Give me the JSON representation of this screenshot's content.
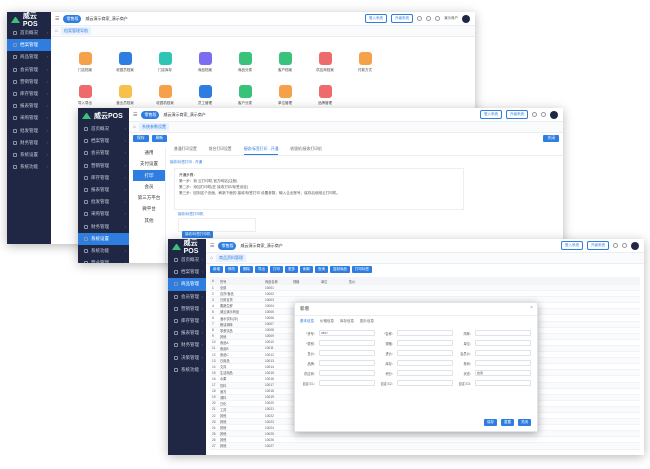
{
  "brand": "威云POS",
  "colors": {
    "sidebar": "#1f2744",
    "accent": "#2e7de0",
    "green": "#39c27a"
  },
  "w1": {
    "topbar": {
      "badge": "零售版",
      "store": "威云演示商家_演示商户",
      "btn1": "登入系统",
      "btn2": "升级系统",
      "user": "演示商户"
    },
    "tab": "档案管理导航",
    "nav": [
      "首页概况",
      "档案管理",
      "商品管理",
      "会员管理",
      "营销管理",
      "库存管理",
      "报表管理",
      "采购管理",
      "批发管理",
      "财务管理",
      "系统设置",
      "系统功能"
    ],
    "grid": [
      {
        "label": "门店档案",
        "color": "#f5a14a"
      },
      {
        "label": "收银员档案",
        "color": "#2e7de0"
      },
      {
        "label": "门店库存",
        "color": "#2ec4b6"
      },
      {
        "label": "商品档案",
        "color": "#7b6cf0"
      },
      {
        "label": "商品分类",
        "color": "#39c27a"
      },
      {
        "label": "客户档案",
        "color": "#39c27a"
      },
      {
        "label": "供应商档案",
        "color": "#ef6b6b"
      },
      {
        "label": "付款方式",
        "color": "#f5a14a"
      },
      {
        "label": "导入导出",
        "color": "#ef6b6b"
      },
      {
        "label": "营业员档案",
        "color": "#f5c14a"
      },
      {
        "label": "收银机档案",
        "color": "#f5a14a"
      },
      {
        "label": "员工管理",
        "color": "#2e7de0"
      },
      {
        "label": "客户分类",
        "color": "#39c27a"
      },
      {
        "label": "单位管理",
        "color": "#f5a14a"
      },
      {
        "label": "品牌管理",
        "color": "#ef6b6b"
      }
    ]
  },
  "w2": {
    "topbar": {
      "badge": "零售版",
      "store": "威云演示商家_演示商户",
      "btn1": "登入系统",
      "btn2": "升级系统"
    },
    "tab": "系统参数设置",
    "nav": [
      "首页概况",
      "档案管理",
      "会员管理",
      "营销管理",
      "库存管理",
      "报表管理",
      "批发管理",
      "采购管理",
      "财务管理",
      "系统设置",
      "系统功能",
      "营业管理",
      "决策管理",
      "系统功能"
    ],
    "toolbar": {
      "save": "保存",
      "refresh": "刷新",
      "right": "关闭"
    },
    "sub_left": [
      "通用",
      "支付设置",
      "打印",
      "会员",
      "第三方平台",
      "微平台",
      "其他"
    ],
    "sub_active": 2,
    "sub_tabs": [
      "普通打印设置",
      "前台打印设置",
      "接收/标签打印 - 开通",
      "收银机/接收打印机"
    ],
    "sub_tab_active": 2,
    "link": "接收/标签打印 - 开通",
    "steps": [
      "开通步骤：",
      "第一步：到 云打印机 官方网站(注册)",
      "第二步：添加打印机(在 接收打印/标签设定)",
      "第三步：回到这个页面，刷新下面的 接收/标签打印 设置参数，输入企业账号，保存后使用云打印机。"
    ],
    "link2": "接收/标签打印机",
    "box_btn": "接收/标签打印机"
  },
  "w3": {
    "topbar": {
      "badge": "零售版",
      "store": "威云演示商家_演示商户",
      "btn1": "登入系统",
      "btn2": "升级系统"
    },
    "tab": "商品资料管理",
    "nav": [
      "首页概况",
      "档案管理",
      "商品管理",
      "会员管理",
      "营销管理",
      "库存管理",
      "报表管理",
      "财务管理",
      "决策管理",
      "系统功能"
    ],
    "toolbar": [
      "新增",
      "修改",
      "删除",
      "导出",
      "打印",
      "更多",
      "刷新",
      "查询",
      "复制商品",
      "打印标签"
    ],
    "table": {
      "head": [
        "#",
        "货号",
        "商品名称",
        "规格",
        "单位",
        "售价"
      ],
      "rows": [
        [
          "1",
          "全部",
          "10001",
          "",
          "",
          ""
        ],
        [
          "2",
          "百货/食品",
          "10002",
          "",
          "",
          ""
        ],
        [
          "3",
          "日用百货",
          "10003",
          "",
          "",
          ""
        ],
        [
          "4",
          "果蔬生鲜",
          "10004",
          "",
          "",
          ""
        ],
        [
          "5",
          "威云演示商品",
          "10005",
          "",
          "",
          ""
        ],
        [
          "6",
          "酒水饮料(中)",
          "10006",
          "",
          "",
          ""
        ],
        [
          "7",
          "粮油调味",
          "10007",
          "",
          "",
          ""
        ],
        [
          "8",
          "零食饮品",
          "10008",
          "",
          "",
          ""
        ],
        [
          "9",
          "其他",
          "10009",
          "",
          "",
          ""
        ],
        [
          "10",
          "食品A",
          "10010",
          "",
          "",
          ""
        ],
        [
          "11",
          "食品B",
          "10011",
          "",
          "",
          ""
        ],
        [
          "12",
          "食品C",
          "10012",
          "",
          "",
          ""
        ],
        [
          "13",
          "日用品",
          "10013",
          "",
          "",
          ""
        ],
        [
          "14",
          "文具",
          "10014",
          "",
          "",
          ""
        ],
        [
          "15",
          "生活用品",
          "10015",
          "",
          "",
          ""
        ],
        [
          "16",
          "水果",
          "10016",
          "",
          "",
          ""
        ],
        [
          "17",
          "饮料",
          "10017",
          "",
          "",
          ""
        ],
        [
          "18",
          "速冻",
          "10018",
          "",
          "",
          ""
        ],
        [
          "19",
          "调料",
          "10019",
          "",
          "",
          ""
        ],
        [
          "20",
          "日化",
          "10020",
          "",
          "",
          ""
        ],
        [
          "21",
          "工具",
          "10021",
          "",
          "",
          ""
        ],
        [
          "22",
          "其他",
          "10022",
          "",
          "",
          ""
        ],
        [
          "23",
          "其他",
          "10023",
          "",
          "",
          ""
        ],
        [
          "24",
          "其他",
          "10024",
          "",
          "",
          ""
        ],
        [
          "25",
          "其他",
          "10025",
          "",
          "",
          ""
        ],
        [
          "26",
          "其他",
          "10026",
          "",
          "",
          ""
        ],
        [
          "27",
          "其他",
          "10027",
          "",
          "",
          ""
        ]
      ]
    },
    "modal": {
      "title": "新增",
      "tabs": [
        "基本信息",
        "价格信息",
        "库存信息",
        "图片信息"
      ],
      "fields": [
        {
          "label": "*货号：",
          "value": "2807"
        },
        {
          "label": "*名称：",
          "value": ""
        },
        {
          "label": "简称：",
          "value": ""
        },
        {
          "label": "*类别：",
          "value": ""
        },
        {
          "label": "规格：",
          "value": ""
        },
        {
          "label": "单位：",
          "value": ""
        },
        {
          "label": "售价：",
          "value": ""
        },
        {
          "label": "进价：",
          "value": ""
        },
        {
          "label": "会员价：",
          "value": ""
        },
        {
          "label": "品牌：",
          "value": ""
        },
        {
          "label": "库存：",
          "value": ""
        },
        {
          "label": "条码：",
          "value": ""
        },
        {
          "label": "供应商：",
          "value": ""
        },
        {
          "label": "积分：",
          "value": ""
        },
        {
          "label": "状态：",
          "value": "启用"
        },
        {
          "label": "自定义1：",
          "value": ""
        },
        {
          "label": "自定义2：",
          "value": ""
        },
        {
          "label": "自定义3：",
          "value": ""
        }
      ],
      "buttons": [
        "保存",
        "重置",
        "关闭"
      ]
    }
  }
}
